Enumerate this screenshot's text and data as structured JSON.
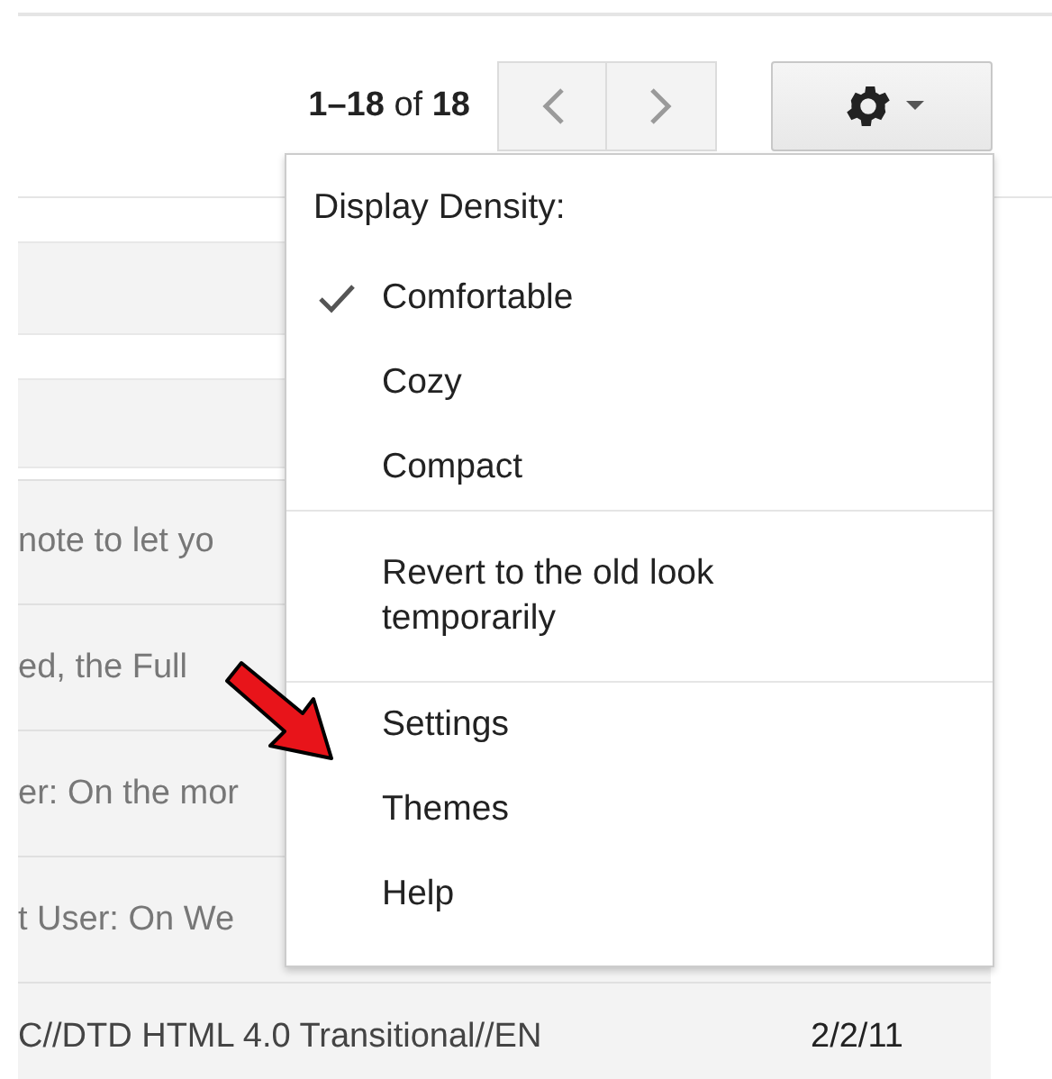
{
  "pager": {
    "text": "**1–18** of **18**"
  },
  "menu": {
    "heading": "Display Density:",
    "density_options": [
      {
        "label": "Comfortable",
        "checked": true
      },
      {
        "label": "Cozy",
        "checked": false
      },
      {
        "label": "Compact",
        "checked": false
      }
    ],
    "revert": "Revert to the old look temporarily",
    "links": [
      "Settings",
      "Themes",
      "Help"
    ]
  },
  "messages": [
    {
      "snippet": "note to let yo"
    },
    {
      "snippet": "ed, the Full"
    },
    {
      "snippet": "er: On the mor"
    },
    {
      "snippet": "t User: On We"
    },
    {
      "snippet": "C//DTD HTML 4.0 Transitional//EN",
      "date": "2/2/11"
    }
  ]
}
